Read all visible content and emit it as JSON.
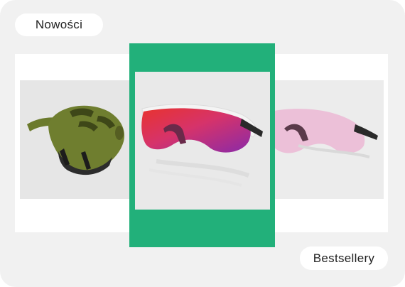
{
  "labels": {
    "new_label": "Nowości",
    "bestsellers_label": "Bestsellery"
  },
  "carousel": {
    "items": [
      {
        "product": "helmet-image",
        "position": "left"
      },
      {
        "product": "sport-sunglasses-red-lens-image",
        "position": "center",
        "selected": true
      },
      {
        "product": "sport-sunglasses-pink-lens-image",
        "position": "right"
      }
    ]
  },
  "colors": {
    "accent": "#22b07a",
    "background": "#f1f1f1",
    "pill": "#ffffff"
  }
}
